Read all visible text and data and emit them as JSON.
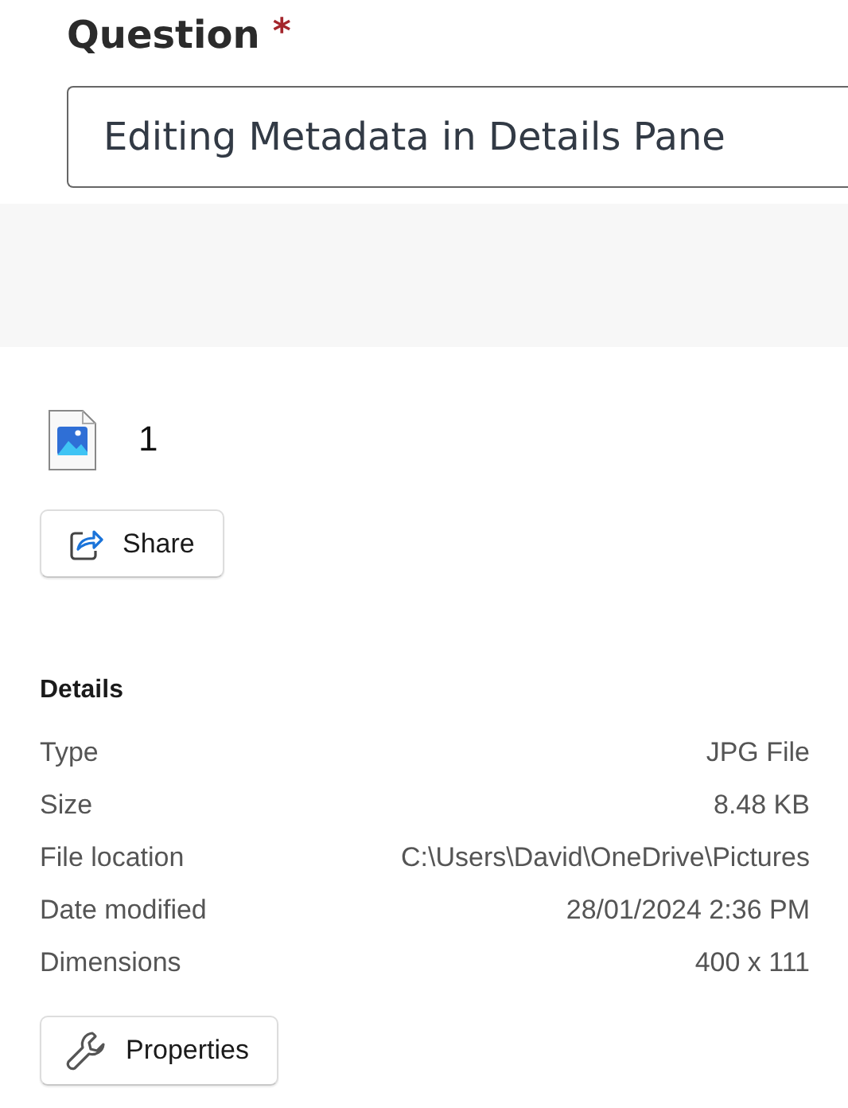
{
  "question": {
    "label": "Question",
    "required_mark": "*",
    "value": "Editing Metadata in Details Pane"
  },
  "file": {
    "name": "1",
    "share_button": "Share"
  },
  "details": {
    "heading": "Details",
    "rows": [
      {
        "label": "Type",
        "value": "JPG File"
      },
      {
        "label": "Size",
        "value": "8.48 KB"
      },
      {
        "label": "File location",
        "value": "C:\\Users\\David\\OneDrive\\Pictures"
      },
      {
        "label": "Date modified",
        "value": "28/01/2024 2:36 PM"
      },
      {
        "label": "Dimensions",
        "value": "400 x 111"
      }
    ],
    "properties_button": "Properties"
  }
}
